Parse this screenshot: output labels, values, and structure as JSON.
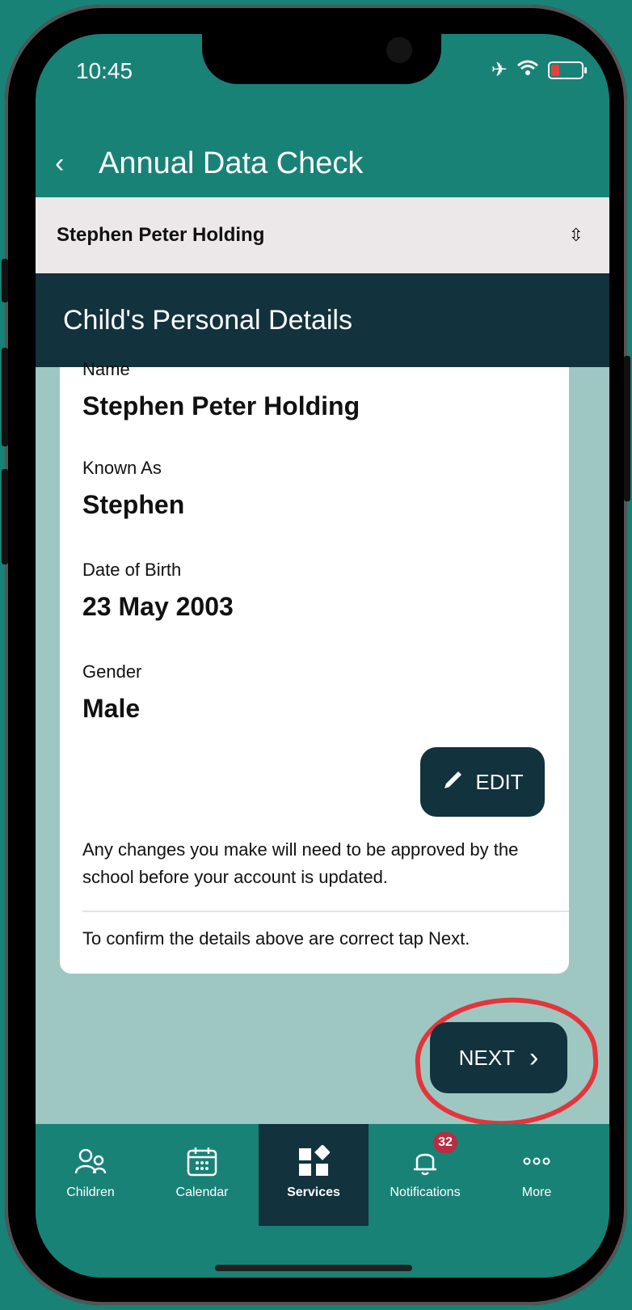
{
  "status": {
    "time": "10:45"
  },
  "header": {
    "title": "Annual Data Check"
  },
  "selector": {
    "value": "Stephen Peter Holding"
  },
  "section": {
    "title": "Child's Personal Details"
  },
  "details": {
    "name_label": "Name",
    "name_value": "Stephen Peter Holding",
    "known_as_label": "Known As",
    "known_as_value": "Stephen",
    "dob_label": "Date of Birth",
    "dob_value": "23 May 2003",
    "gender_label": "Gender",
    "gender_value": "Male"
  },
  "actions": {
    "edit_label": "EDIT",
    "next_label": "NEXT"
  },
  "notes": {
    "approval": "Any changes you make will need to be approved by the school before your account is updated.",
    "confirm": "To confirm the details above are correct tap Next."
  },
  "nav": {
    "items": [
      {
        "label": "Children",
        "icon": "person-icon"
      },
      {
        "label": "Calendar",
        "icon": "calendar-icon"
      },
      {
        "label": "Services",
        "icon": "services-icon",
        "active": true
      },
      {
        "label": "Notifications",
        "icon": "bell-icon",
        "badge": "32"
      },
      {
        "label": "More",
        "icon": "more-icon"
      }
    ]
  },
  "colors": {
    "teal": "#188277",
    "dark": "#12323d",
    "light_teal": "#9fc7c2",
    "badge_red": "#ba2c3f",
    "annotation_red": "#e5343a"
  }
}
